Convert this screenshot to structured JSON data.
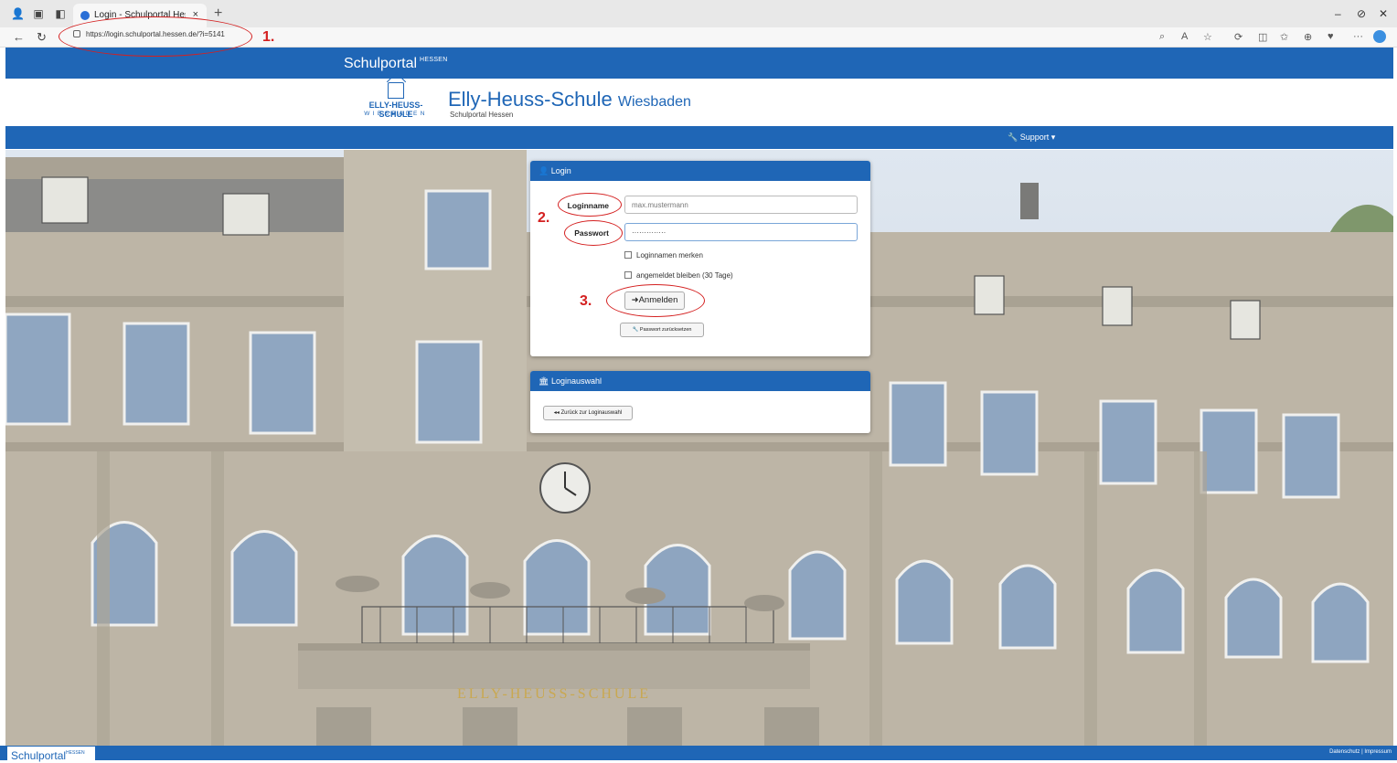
{
  "browser": {
    "tab_title": "Login - Schulportal Hessen",
    "tab_close": "×",
    "new_tab": "+",
    "url": "https://login.schulportal.hessen.de/?i=5141",
    "window_controls": [
      "–",
      "⊘",
      "✕"
    ]
  },
  "annotations": {
    "step1": "1.",
    "step2": "2.",
    "step3": "3."
  },
  "site": {
    "brand": "Schulportal",
    "brand_sup": "HESSEN",
    "logo_line1": "ELLY-HEUSS-SCHULE",
    "logo_line2": "WIESBADEN",
    "school_name": "Elly-Heuss-Schule",
    "school_city": "Wiesbaden",
    "school_sub": "Schulportal Hessen",
    "support": "Support"
  },
  "login": {
    "header": "Login",
    "username_label": "Loginname",
    "username_placeholder": "max.mustermann",
    "password_label": "Passwort",
    "password_value": "··············",
    "remember_name": "Loginnamen merken",
    "stay_logged": "angemeldet bleiben (30 Tage)",
    "submit": "Anmelden",
    "reset": "Passwort zurücksetzen"
  },
  "loginauswahl": {
    "header": "Loginauswahl",
    "back": "Zurück zur Loginauswahl"
  },
  "building": {
    "inscription": "ELLY-HEUSS-SCHULE"
  },
  "footer": {
    "brand": "Schulportal",
    "brand_sup": "HESSEN",
    "links": "Datenschutz  |  Impressum"
  },
  "colors": {
    "primary": "#1f66b6",
    "annotation": "#d42020"
  }
}
